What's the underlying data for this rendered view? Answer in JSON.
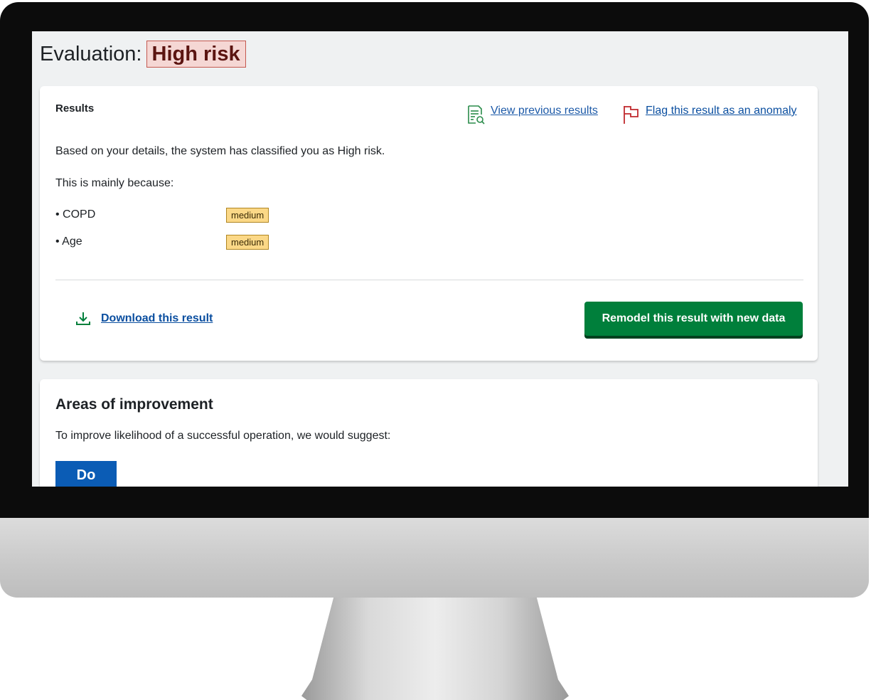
{
  "header": {
    "title_prefix": "Evaluation:",
    "risk_level": "High risk"
  },
  "results": {
    "heading": "Results",
    "view_previous_label": "View previous results",
    "flag_label": "Flag this result as an anomaly",
    "summary": "Based on your details, the system has classified you as High risk.",
    "because_intro": "This is mainly because:",
    "reasons": [
      {
        "name": "• COPD",
        "level": "medium"
      },
      {
        "name": "• Age",
        "level": "medium"
      }
    ],
    "download_label": "Download this result",
    "remodel_label": "Remodel this result with new data"
  },
  "improvement": {
    "heading": "Areas of improvement",
    "intro": "To improve likelihood of a successful operation, we would suggest:",
    "do_label": "Do"
  },
  "colors": {
    "risk_badge_bg": "#f5d7d4",
    "level_tag_bg": "#fbd887",
    "primary_button": "#007f3b",
    "link": "#0b4fa0",
    "do_tag": "#0b5cb5",
    "flag_icon": "#c0282d",
    "document_icon": "#2a8c4a"
  },
  "icons": [
    "document-search-icon",
    "flag-icon",
    "download-icon"
  ]
}
